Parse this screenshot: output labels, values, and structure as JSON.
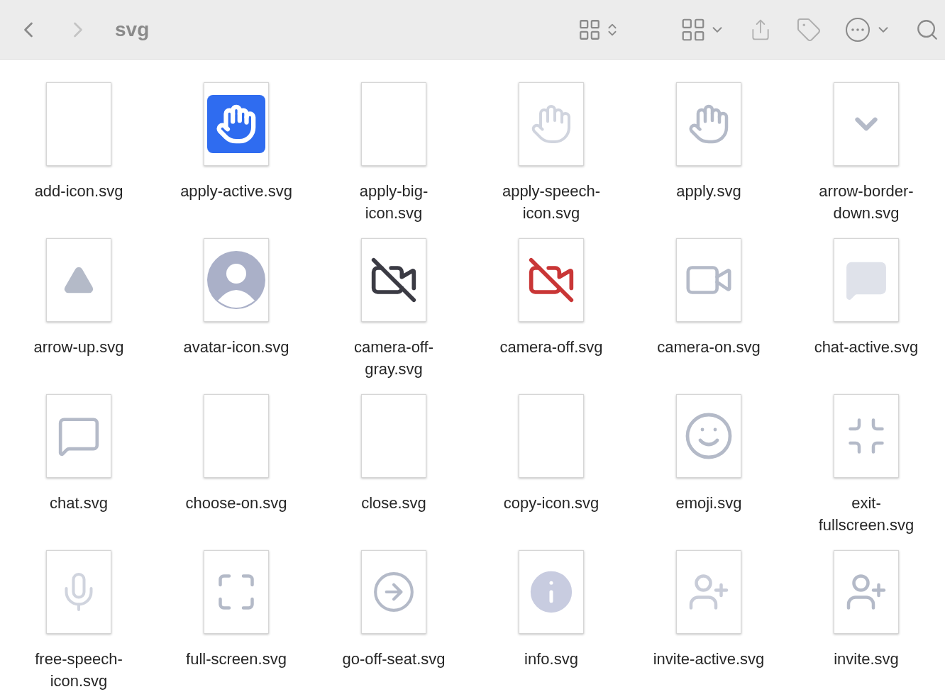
{
  "toolbar": {
    "title": "svg",
    "back": {
      "disabled": false
    },
    "forward": {
      "disabled": true
    }
  },
  "files": [
    {
      "name": "add-icon.svg",
      "selected": false
    },
    {
      "name": "apply-active.svg",
      "selected": false
    },
    {
      "name": "apply-big-icon.svg",
      "selected": false
    },
    {
      "name": "apply-speech-icon.svg",
      "selected": false
    },
    {
      "name": "apply.svg",
      "selected": false
    },
    {
      "name": "arrow-border-down.svg",
      "selected": false
    },
    {
      "name": "arrow-up.svg",
      "selected": false
    },
    {
      "name": "avatar-icon.svg",
      "selected": false
    },
    {
      "name": "camera-off-gray.svg",
      "selected": false
    },
    {
      "name": "camera-off.svg",
      "selected": false
    },
    {
      "name": "camera-on.svg",
      "selected": false
    },
    {
      "name": "chat-active.svg",
      "selected": false
    },
    {
      "name": "chat.svg",
      "selected": false
    },
    {
      "name": "choose-on.svg",
      "selected": false
    },
    {
      "name": "close.svg",
      "selected": false
    },
    {
      "name": "copy-icon.svg",
      "selected": false
    },
    {
      "name": "emoji.svg",
      "selected": false
    },
    {
      "name": "exit-fullscreen.svg",
      "selected": false
    },
    {
      "name": "free-speech-icon.svg",
      "selected": false
    },
    {
      "name": "full-screen.svg",
      "selected": false
    },
    {
      "name": "go-off-seat.svg",
      "selected": false
    },
    {
      "name": "info.svg",
      "selected": false
    },
    {
      "name": "invite-active.svg",
      "selected": false
    },
    {
      "name": "invite.svg",
      "selected": false
    }
  ]
}
